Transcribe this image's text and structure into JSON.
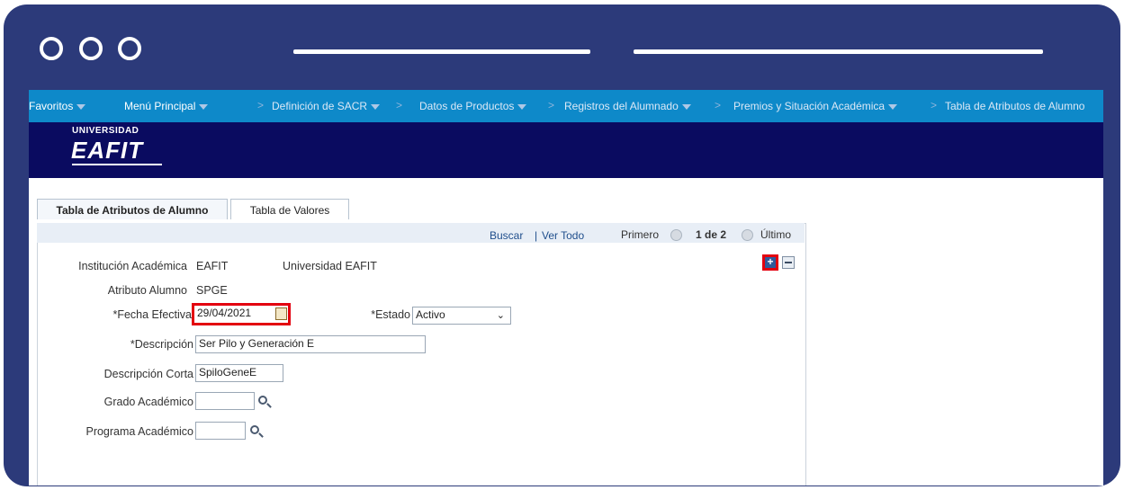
{
  "nav": {
    "items": [
      "Favoritos",
      "Menú Principal",
      "Definición de SACR",
      "Datos de Productos",
      "Registros del Alumnado",
      "Premios y Situación Académica",
      "Tabla de Atributos de Alumno"
    ],
    "separator": ">"
  },
  "brand": {
    "top": "UNIVERSIDAD",
    "main": "EAFIT"
  },
  "tabs": [
    "Tabla de Atributos de Alumno",
    "Tabla de Valores"
  ],
  "pager": {
    "search": "Buscar",
    "divider": "|",
    "view_all": "Ver Todo",
    "first": "Primero",
    "count": "1 de 2",
    "last": "Último"
  },
  "form": {
    "institucion_label": "Institución Académica",
    "institucion_code": "EAFIT",
    "institucion_name": "Universidad EAFIT",
    "atributo_label": "Atributo Alumno",
    "atributo_value": "SPGE",
    "fecha_label": "*Fecha Efectiva",
    "fecha_value": "29/04/2021",
    "estado_label": "*Estado",
    "estado_value": "Activo",
    "descripcion_label": "*Descripción",
    "descripcion_value": "Ser Pilo y Generación E",
    "desc_corta_label": "Descripción Corta",
    "desc_corta_value": "SpiloGeneE",
    "grado_label": "Grado Académico",
    "grado_value": "",
    "programa_label": "Programa Académico",
    "programa_value": ""
  },
  "colors": {
    "frame": "#2c3a7a",
    "nav": "#0e89c9",
    "banner": "#0a0b60",
    "highlight": "#e3000f"
  }
}
